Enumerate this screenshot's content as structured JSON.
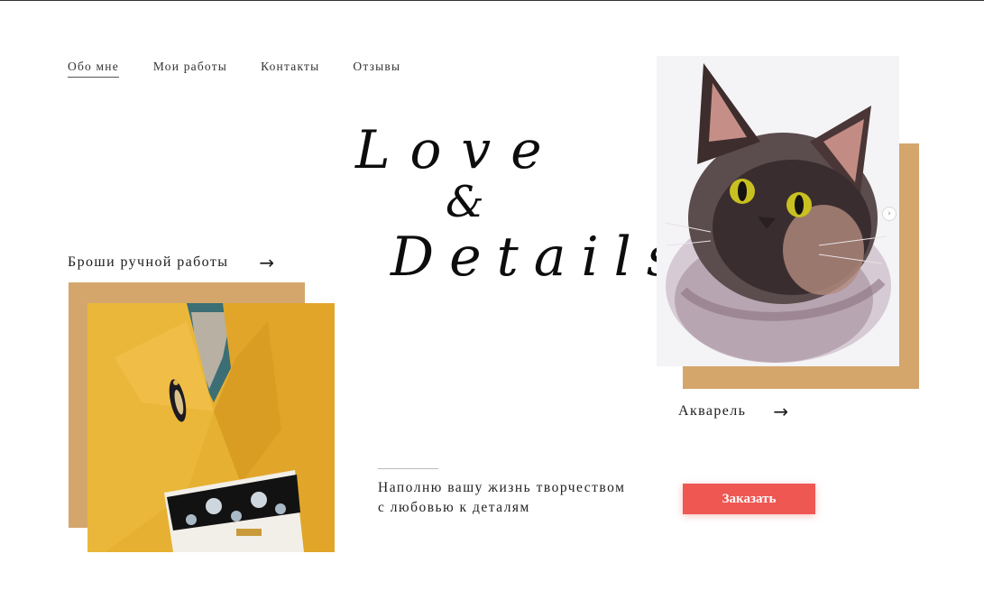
{
  "nav": {
    "items": [
      "Обо мне",
      "Мои работы",
      "Контакты",
      "Отзывы"
    ],
    "active_index": 0
  },
  "hero": {
    "line1": "Love",
    "line2": "&",
    "line3": "Details"
  },
  "brooches": {
    "label": "Броши ручной работы",
    "arrow": "→"
  },
  "watercolor": {
    "label": "Акварель",
    "arrow": "→"
  },
  "tagline": {
    "line1": "Наполню вашу жизнь творчеством",
    "line2": "с любовью к деталям"
  },
  "order_button": {
    "label": "Заказать"
  },
  "slider": {
    "next_glyph": "›"
  },
  "colors": {
    "accent_tan": "#d4a66c",
    "button_red": "#ef5753",
    "coat_yellow": "#e3ad2d"
  }
}
